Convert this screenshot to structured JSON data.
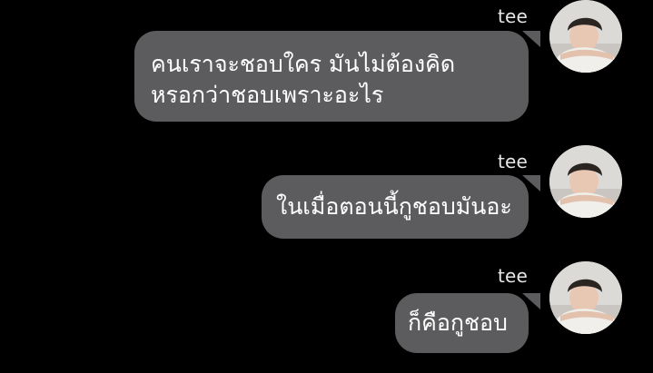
{
  "colors": {
    "background": "#000000",
    "bubble": "#5c5c5e",
    "text": "#ffffff",
    "sender": "#e6e6e6"
  },
  "messages": [
    {
      "sender": "tee",
      "text": "คนเราจะชอบใคร มันไม่ต้องคิด\nหรอกว่าชอบเพราะอะไร",
      "avatar_icon": "profile-photo-icon"
    },
    {
      "sender": "tee",
      "text": "ในเมื่อตอนนี้กูชอบมันอะ",
      "avatar_icon": "profile-photo-icon"
    },
    {
      "sender": "tee",
      "text": "ก็คือกูชอบ",
      "avatar_icon": "profile-photo-icon"
    }
  ]
}
